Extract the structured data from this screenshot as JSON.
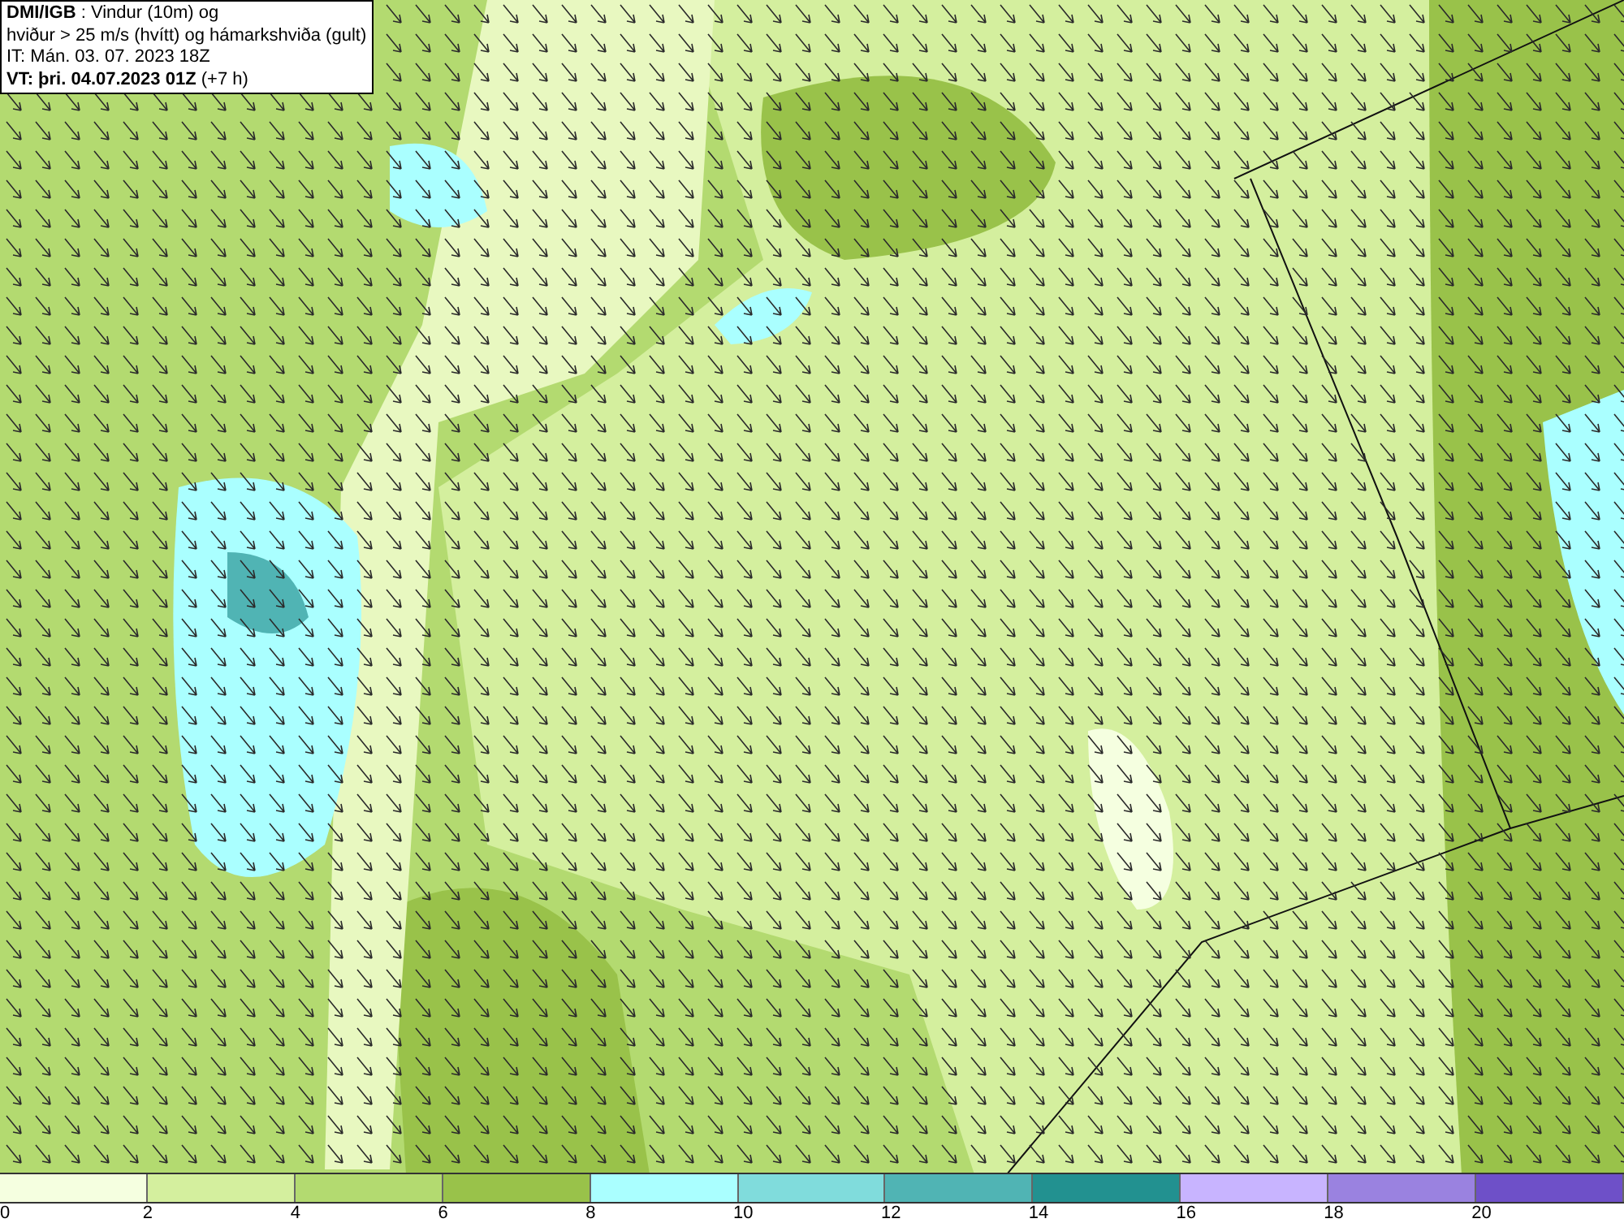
{
  "header": {
    "lines": [
      "**DMI/IGB** : Vindur (10m) og",
      "hviður > 25 m/s (hvítt) og hámarkshviða (gult)",
      "IT: Mán. 03. 07. 2023 18Z",
      "**VT: þri. 04.07.2023 01Z** (+7 h)"
    ]
  },
  "legend": {
    "segments": [
      {
        "color": "#f5ffe0"
      },
      {
        "color": "#d4ef9e"
      },
      {
        "color": "#b3da70"
      },
      {
        "color": "#99c24a"
      },
      {
        "color": "#aaffff"
      },
      {
        "color": "#80dcdc"
      },
      {
        "color": "#50b4b4"
      },
      {
        "color": "#229190"
      },
      {
        "color": "#c8b4ff"
      },
      {
        "color": "#9a82e0"
      },
      {
        "color": "#6e50c8"
      }
    ],
    "ticks": [
      "0",
      "2",
      "4",
      "6",
      "8",
      "10",
      "12",
      "14",
      "16",
      "18",
      "20"
    ]
  }
}
